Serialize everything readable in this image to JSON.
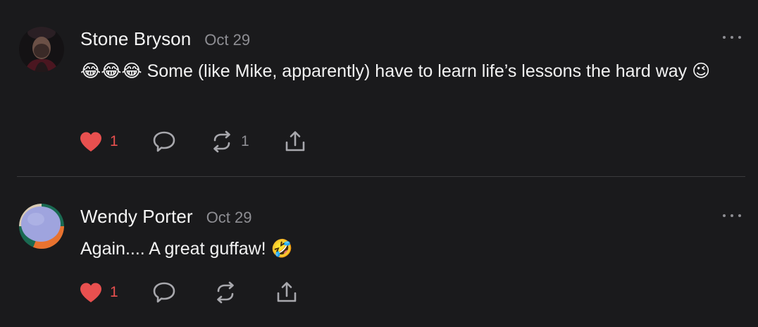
{
  "comments": [
    {
      "author": "Stone Bryson",
      "date": "Oct 29",
      "body": "😂😂😂 Some (like Mike, apparently) have to learn life’s lessons the hard way 😉",
      "likes": "1",
      "restacks": "1",
      "liked": true
    },
    {
      "author": "Wendy Porter",
      "date": "Oct 29",
      "body": "Again.... A great guffaw! 🤣",
      "likes": "1",
      "restacks": "",
      "liked": true
    }
  ],
  "colors": {
    "background": "#1a1a1c",
    "like_red": "#e8504f",
    "muted": "#8e8e93",
    "icon": "#a8a8ad"
  },
  "icons": [
    "heart-icon",
    "comment-bubble-icon",
    "restack-icon",
    "share-icon",
    "more-horizontal-icon"
  ]
}
